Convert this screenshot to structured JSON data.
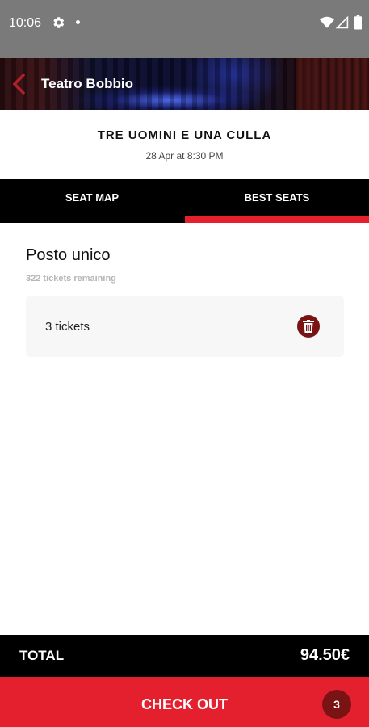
{
  "status_bar": {
    "time": "10:06",
    "icons": [
      "gear-icon",
      "dot-icon",
      "wifi-icon",
      "signal-icon",
      "battery-icon"
    ]
  },
  "header": {
    "venue": "Teatro Bobbio",
    "back_icon": "chevron-left-icon"
  },
  "event": {
    "title": "TRE UOMINI E UNA CULLA",
    "date": "28 Apr at 8:30 PM"
  },
  "tabs": [
    {
      "label": "SEAT MAP",
      "active": false
    },
    {
      "label": "BEST SEATS",
      "active": true
    }
  ],
  "section": {
    "title": "Posto unico",
    "remaining": "322 tickets remaining"
  },
  "ticket": {
    "label": "3 tickets",
    "delete_icon": "trash-icon"
  },
  "total": {
    "label": "TOTAL",
    "value": "94.50€"
  },
  "checkout": {
    "label": "CHECK OUT",
    "count": "3"
  },
  "colors": {
    "accent": "#e4202f",
    "badge": "#7a1414",
    "bar": "#000000",
    "status_bar": "#7a7a7a"
  }
}
